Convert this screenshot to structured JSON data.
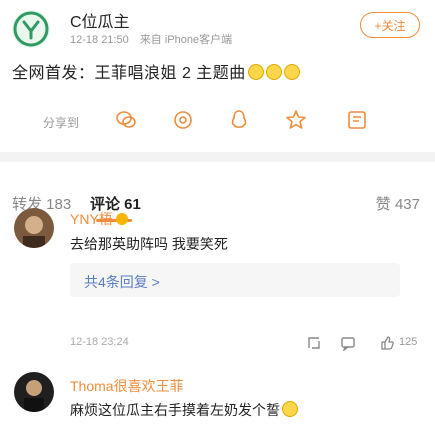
{
  "post": {
    "username": "C位瓜主",
    "time": "12-18 21:50",
    "source": "来自 iPhone客户端",
    "follow_label": "+关注",
    "text": "全网首发：王菲唱浪姐 2 主题曲"
  },
  "share_row": {
    "label": "分享到",
    "icons": [
      "wechat-icon",
      "moments-icon",
      "qq-icon",
      "star-icon",
      "weibo-icon"
    ]
  },
  "tabs": {
    "repost": "转发 183",
    "comments": "评论 61",
    "likes": "赞 437"
  },
  "comments": [
    {
      "name": "YNY梧",
      "text": "去给那英助阵吗 我要笑死",
      "replies_link": "共4条回复 >",
      "time": "12-18 23:24",
      "like_count": "125"
    },
    {
      "name": "Thoma很喜欢王菲",
      "text": "麻烦这位瓜主右手摸着左奶发个誓"
    }
  ],
  "colors": {
    "accent": "#f28c3b",
    "link": "#5a7cc7",
    "brand_avatar": "#2f9a63"
  }
}
